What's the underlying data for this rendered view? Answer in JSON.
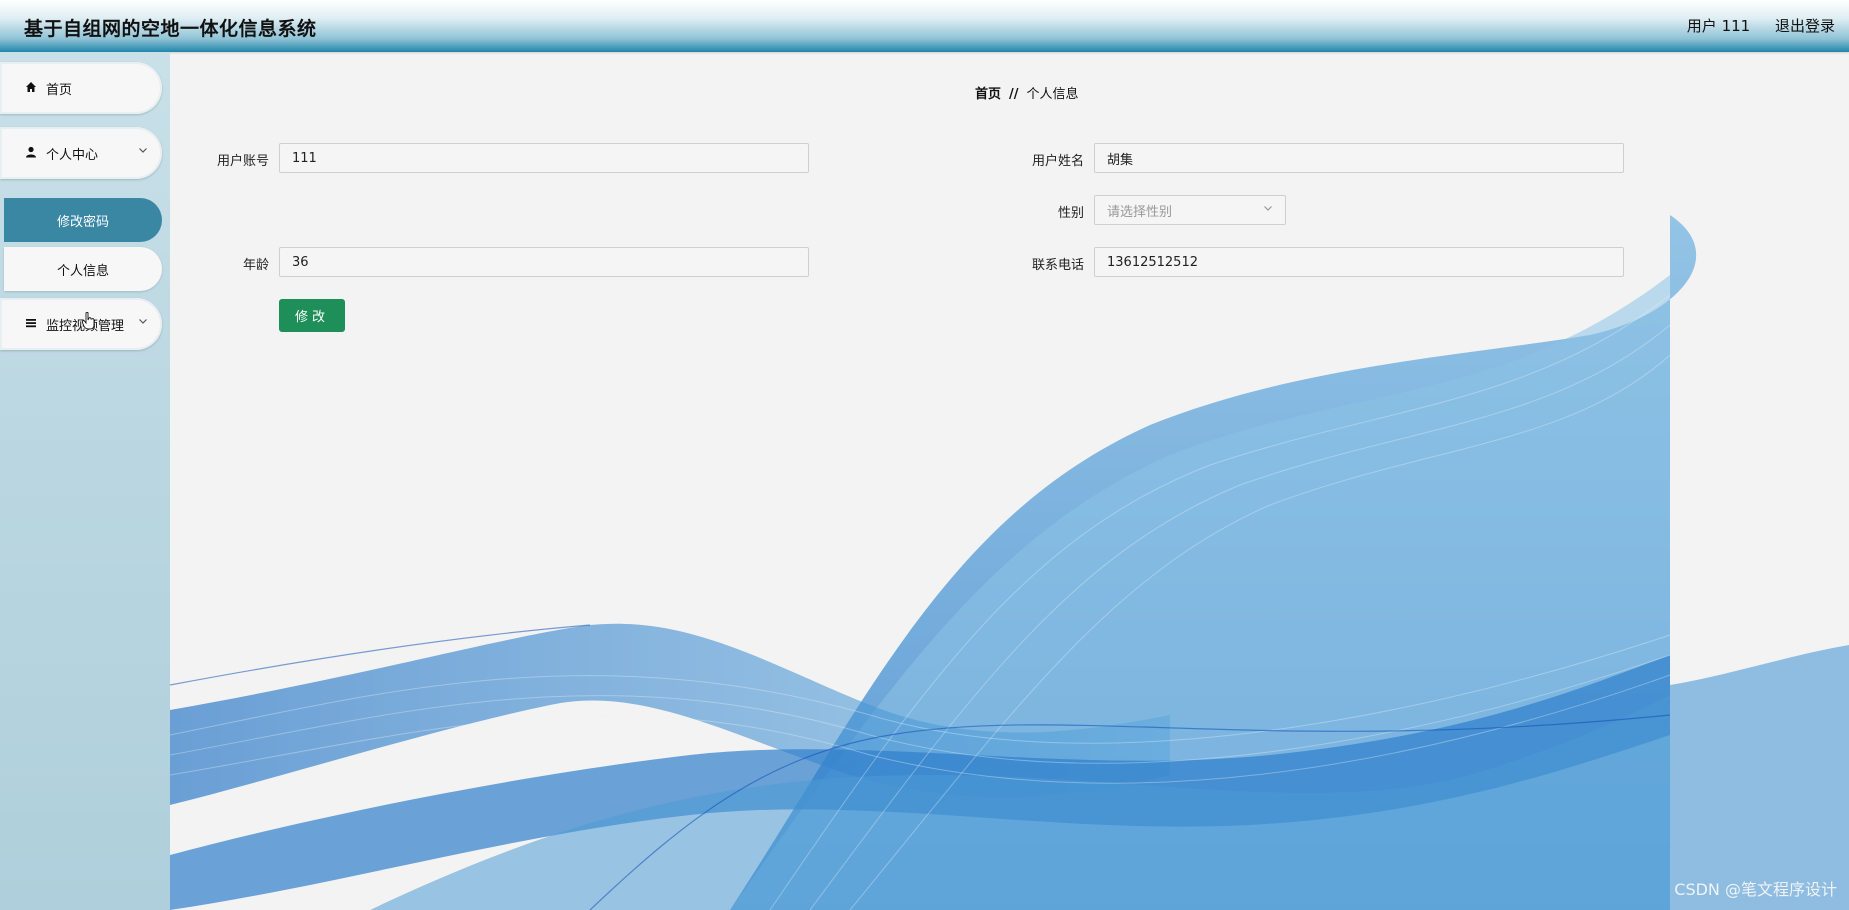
{
  "header": {
    "title": "基于自组网的空地一体化信息系统",
    "user_label": "用户 111",
    "logout_label": "退出登录"
  },
  "sidebar": {
    "home": {
      "label": "首页",
      "icon": "home-icon"
    },
    "personal_center": {
      "label": "个人中心",
      "icon": "user-icon"
    },
    "sub_items": [
      {
        "label": "修改密码",
        "active": true
      },
      {
        "label": "个人信息",
        "active": false
      }
    ],
    "monitor": {
      "label": "监控视频管理",
      "icon": "list-icon"
    }
  },
  "breadcrumb": {
    "home": "首页",
    "separator": "//",
    "current": "个人信息"
  },
  "form": {
    "account": {
      "label": "用户账号",
      "value": "111"
    },
    "name": {
      "label": "用户姓名",
      "value": "胡集"
    },
    "gender": {
      "label": "性别",
      "placeholder": "请选择性别"
    },
    "age": {
      "label": "年龄",
      "value": "36"
    },
    "phone": {
      "label": "联系电话",
      "value": "13612512512"
    },
    "submit_label": "修改"
  },
  "watermark": "CSDN @笔文程序设计",
  "colors": {
    "active_menu": "#3a87a3",
    "submit_button": "#1f8f5a",
    "wave_blue": "#1c6fc4"
  }
}
